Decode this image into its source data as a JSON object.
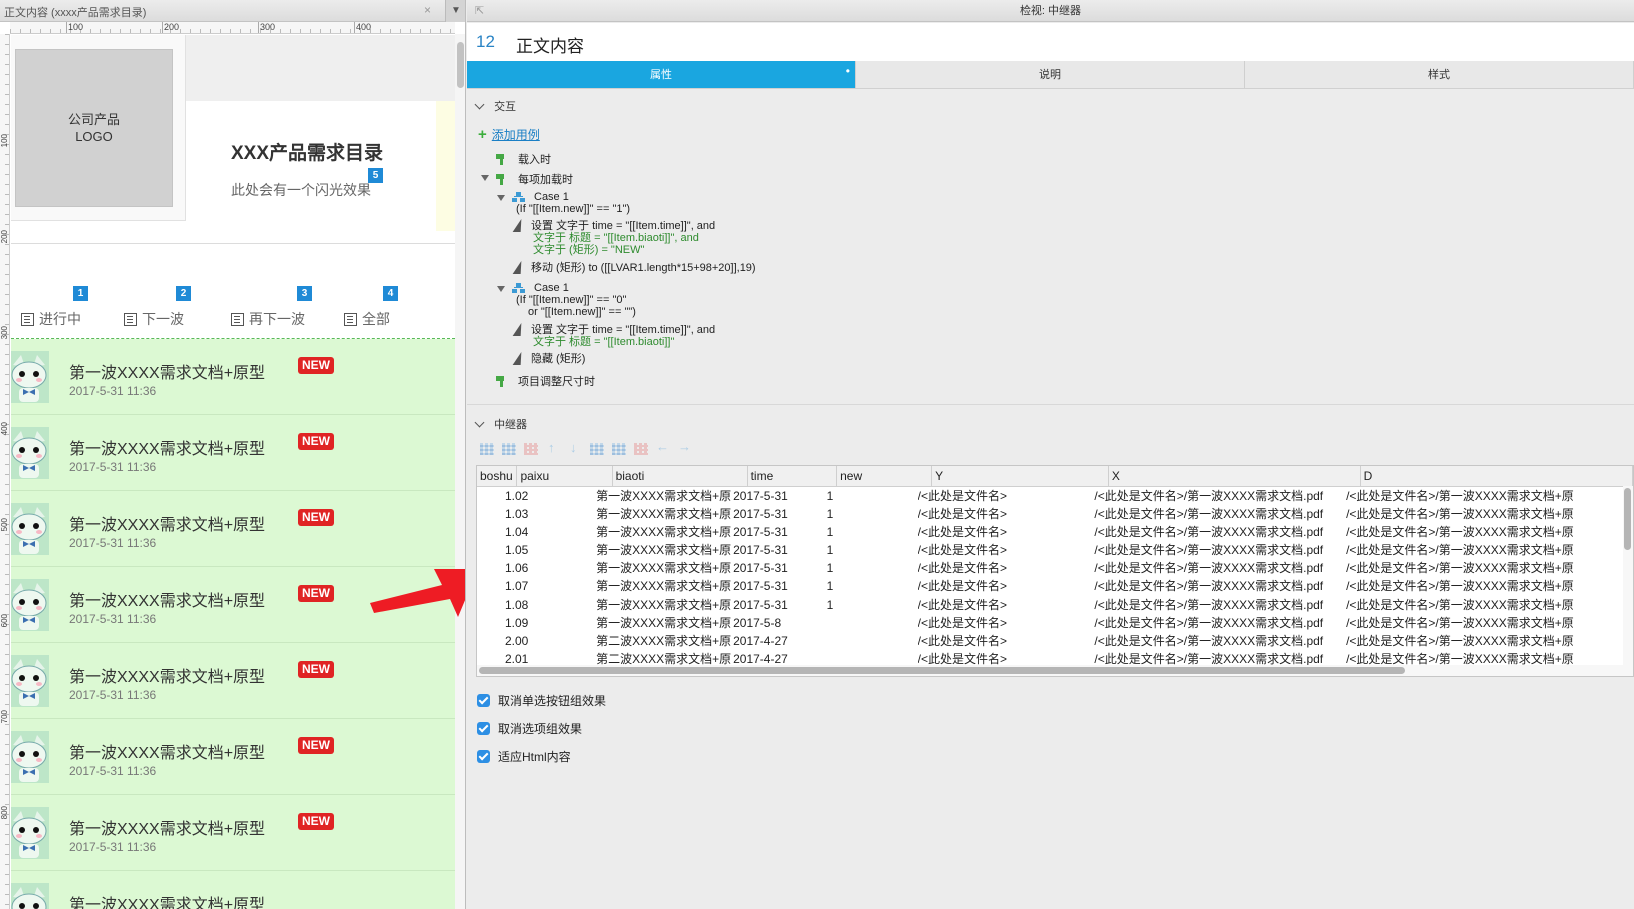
{
  "left_panel": {
    "tab_title": "正文内容 (xxxx产品需求目录)",
    "close_glyph": "×",
    "ruler_h": [
      "100",
      "200",
      "300",
      "400"
    ],
    "ruler_v": [
      "100",
      "200",
      "300",
      "400",
      "500",
      "600",
      "700",
      "800"
    ],
    "logo_text_1": "公司产品",
    "logo_text_2": "LOGO",
    "product_title": "XXX产品需求目录",
    "flash_text": "此处会有一个闪光效果",
    "badge_5": "5",
    "nav": [
      {
        "label": "进行中",
        "badge": "1"
      },
      {
        "label": "下一波",
        "badge": "2"
      },
      {
        "label": "再下一波",
        "badge": "3"
      },
      {
        "label": "全部",
        "badge": "4"
      }
    ],
    "list_items": [
      {
        "title": "第一波XXXX需求文档+原型",
        "time": "2017-5-31 11:36",
        "tag": "NEW"
      },
      {
        "title": "第一波XXXX需求文档+原型",
        "time": "2017-5-31 11:36",
        "tag": "NEW"
      },
      {
        "title": "第一波XXXX需求文档+原型",
        "time": "2017-5-31 11:36",
        "tag": "NEW"
      },
      {
        "title": "第一波XXXX需求文档+原型",
        "time": "2017-5-31 11:36",
        "tag": "NEW"
      },
      {
        "title": "第一波XXXX需求文档+原型",
        "time": "2017-5-31 11:36",
        "tag": "NEW"
      },
      {
        "title": "第一波XXXX需求文档+原型",
        "time": "2017-5-31 11:36",
        "tag": "NEW"
      },
      {
        "title": "第一波XXXX需求文档+原型",
        "time": "2017-5-31 11:36",
        "tag": "NEW"
      },
      {
        "title": "第一波XXXX需求文档+原型",
        "time": "",
        "tag": ""
      }
    ]
  },
  "inspector": {
    "title": "检视: 中继器",
    "widget_number": "12",
    "widget_name": "正文内容",
    "tabs": [
      {
        "label": "属性",
        "active": true
      },
      {
        "label": "说明",
        "active": false
      },
      {
        "label": "样式",
        "active": false
      }
    ],
    "interaction": {
      "section_label": "交互",
      "add_case": "添加用例",
      "ev_load": "载入时",
      "ev_item_load": "每项加载时",
      "case1_label": "Case 1",
      "case1_cond": "(If \"[[Item.new]]\" == \"1\")",
      "case1_set_1": "设置 文字于 time = \"[[Item.time]]\", and",
      "case1_set_2": "文字于 标题 = \"[[Item.biaoti]]\", and",
      "case1_set_3": "文字于 (矩形) = \"NEW\"",
      "case1_move": "移动 (矩形) to ([[LVAR1.length*15+98+20]],19)",
      "case2_label": "Case 1",
      "case2_cond_1": "(If \"[[Item.new]]\" == \"0\"",
      "case2_cond_2": "or \"[[Item.new]]\" == \"\")",
      "case2_set_1": "设置 文字于 time = \"[[Item.time]]\", and",
      "case2_set_2": "文字于 标题 = \"[[Item.biaoti]]\"",
      "case2_hide": "隐藏 (矩形)",
      "ev_resize": "项目调整尺寸时"
    },
    "repeater": {
      "section_label": "中继器",
      "columns": [
        "boshu",
        "paixu",
        "biaoti",
        "time",
        "new",
        "Y",
        "X",
        "D"
      ],
      "rows": [
        [
          "",
          "1.02",
          "第一波XXXX需求文档+原",
          "2017-5-31",
          "1",
          "/<此处是文件名>",
          "/<此处是文件名>/第一波XXXX需求文档.pdf",
          "/<此处是文件名>/第一波XXXX需求文档+原"
        ],
        [
          "",
          "1.03",
          "第一波XXXX需求文档+原",
          "2017-5-31",
          "1",
          "/<此处是文件名>",
          "/<此处是文件名>/第一波XXXX需求文档.pdf",
          "/<此处是文件名>/第一波XXXX需求文档+原"
        ],
        [
          "",
          "1.04",
          "第一波XXXX需求文档+原",
          "2017-5-31",
          "1",
          "/<此处是文件名>",
          "/<此处是文件名>/第一波XXXX需求文档.pdf",
          "/<此处是文件名>/第一波XXXX需求文档+原"
        ],
        [
          "",
          "1.05",
          "第一波XXXX需求文档+原",
          "2017-5-31",
          "1",
          "/<此处是文件名>",
          "/<此处是文件名>/第一波XXXX需求文档.pdf",
          "/<此处是文件名>/第一波XXXX需求文档+原"
        ],
        [
          "",
          "1.06",
          "第一波XXXX需求文档+原",
          "2017-5-31",
          "1",
          "/<此处是文件名>",
          "/<此处是文件名>/第一波XXXX需求文档.pdf",
          "/<此处是文件名>/第一波XXXX需求文档+原"
        ],
        [
          "",
          "1.07",
          "第一波XXXX需求文档+原",
          "2017-5-31",
          "1",
          "/<此处是文件名>",
          "/<此处是文件名>/第一波XXXX需求文档.pdf",
          "/<此处是文件名>/第一波XXXX需求文档+原"
        ],
        [
          "",
          "1.08",
          "第一波XXXX需求文档+原",
          "2017-5-31",
          "1",
          "/<此处是文件名>",
          "/<此处是文件名>/第一波XXXX需求文档.pdf",
          "/<此处是文件名>/第一波XXXX需求文档+原"
        ],
        [
          "",
          "1.09",
          "第一波XXXX需求文档+原",
          "2017-5-8",
          "",
          "/<此处是文件名>",
          "/<此处是文件名>/第一波XXXX需求文档.pdf",
          "/<此处是文件名>/第一波XXXX需求文档+原"
        ],
        [
          "",
          "2.00",
          "第二波XXXX需求文档+原",
          "2017-4-27",
          "",
          "/<此处是文件名>",
          "/<此处是文件名>/第一波XXXX需求文档.pdf",
          "/<此处是文件名>/第一波XXXX需求文档+原"
        ],
        [
          "",
          "2.01",
          "第二波XXXX需求文档+原",
          "2017-4-27",
          "",
          "/<此处是文件名>",
          "/<此处是文件名>/第一波XXXX需求文档.pdf",
          "/<此处是文件名>/第一波XXXX需求文档+原"
        ]
      ]
    },
    "options": [
      {
        "label": "取消单选按钮组效果",
        "checked": true
      },
      {
        "label": "取消选项组效果",
        "checked": true
      },
      {
        "label": "适应Html内容",
        "checked": true
      }
    ]
  },
  "colors": {
    "accent_tab": "#1aa6e0",
    "list_bg": "#dcf9d3",
    "new_tag": "#e02424",
    "badge": "#1f8ad6",
    "arrow": "#ee1c24"
  }
}
